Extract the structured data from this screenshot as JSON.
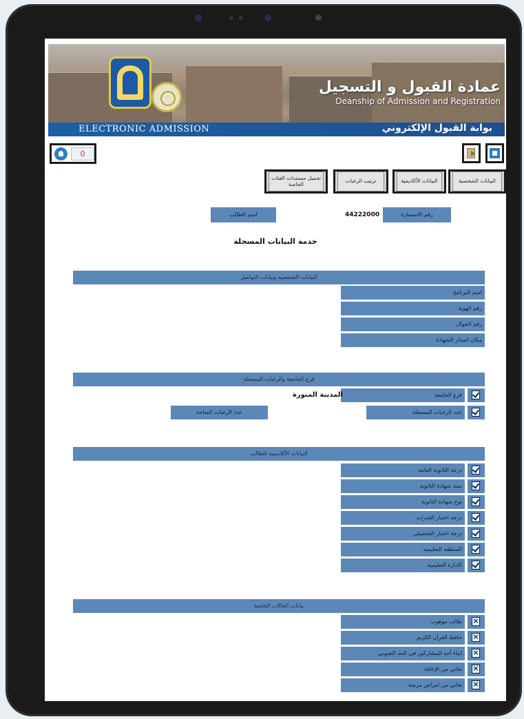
{
  "banner": {
    "title_ar": "عمادة القبول و التسجيل",
    "title_en": "Deanship of Admission and Registration",
    "strip_en": "ELECTRONIC ADMISSION",
    "strip_ar": "بوابة القبول الإلكتروني"
  },
  "toolbar": {
    "notification_count": "0"
  },
  "tabs": [
    "البيانات الشخصية",
    "البيانات الأكاديمية",
    "ترتيب الرغبات",
    "تحميل مستندات الفئات الخاصة"
  ],
  "info": {
    "app_no_label": "رقم الاستمارة",
    "app_no_value": "44222000",
    "student_name_label": "اسم الطالب"
  },
  "service_title": "خدمة البيانات المسجلة",
  "personal": {
    "title": "البيانات الشخصية وبيانات التواصل",
    "fields": [
      "اسم البرنامج",
      "رقم الهوية",
      "رقم الجوال",
      "مكان اصدار الشهادة"
    ]
  },
  "branch": {
    "title": "فرع الجامعة والرغبات المسجلة",
    "branch_label": "فرع الجامعة",
    "branch_value": "المدينة المنورة",
    "wishes_label": "عدد الرغبات المسجلة",
    "available_label": "عدد الرغبات المتاحة"
  },
  "academic": {
    "title": "البيانات الأكاديمية للطالب",
    "fields": [
      "درجة الثانوية العامة",
      "سنة شهادة الثانوية",
      "نوع شهادة الثانوية",
      "درجة اختبار القدرات",
      "درجة اختبار التحصيلي",
      "المنطقة التعليمية",
      "الادارة التعليمية"
    ]
  },
  "special": {
    "title": "بيانات الحالات الخاصة",
    "fields": [
      "طالب موهوب",
      "حافظ القرآن الكريم",
      "ابناء أحد المشاركين في الحد الجنوبي",
      "تعاني من الإعاقة",
      "تعاني من امراض مزمنة"
    ]
  }
}
